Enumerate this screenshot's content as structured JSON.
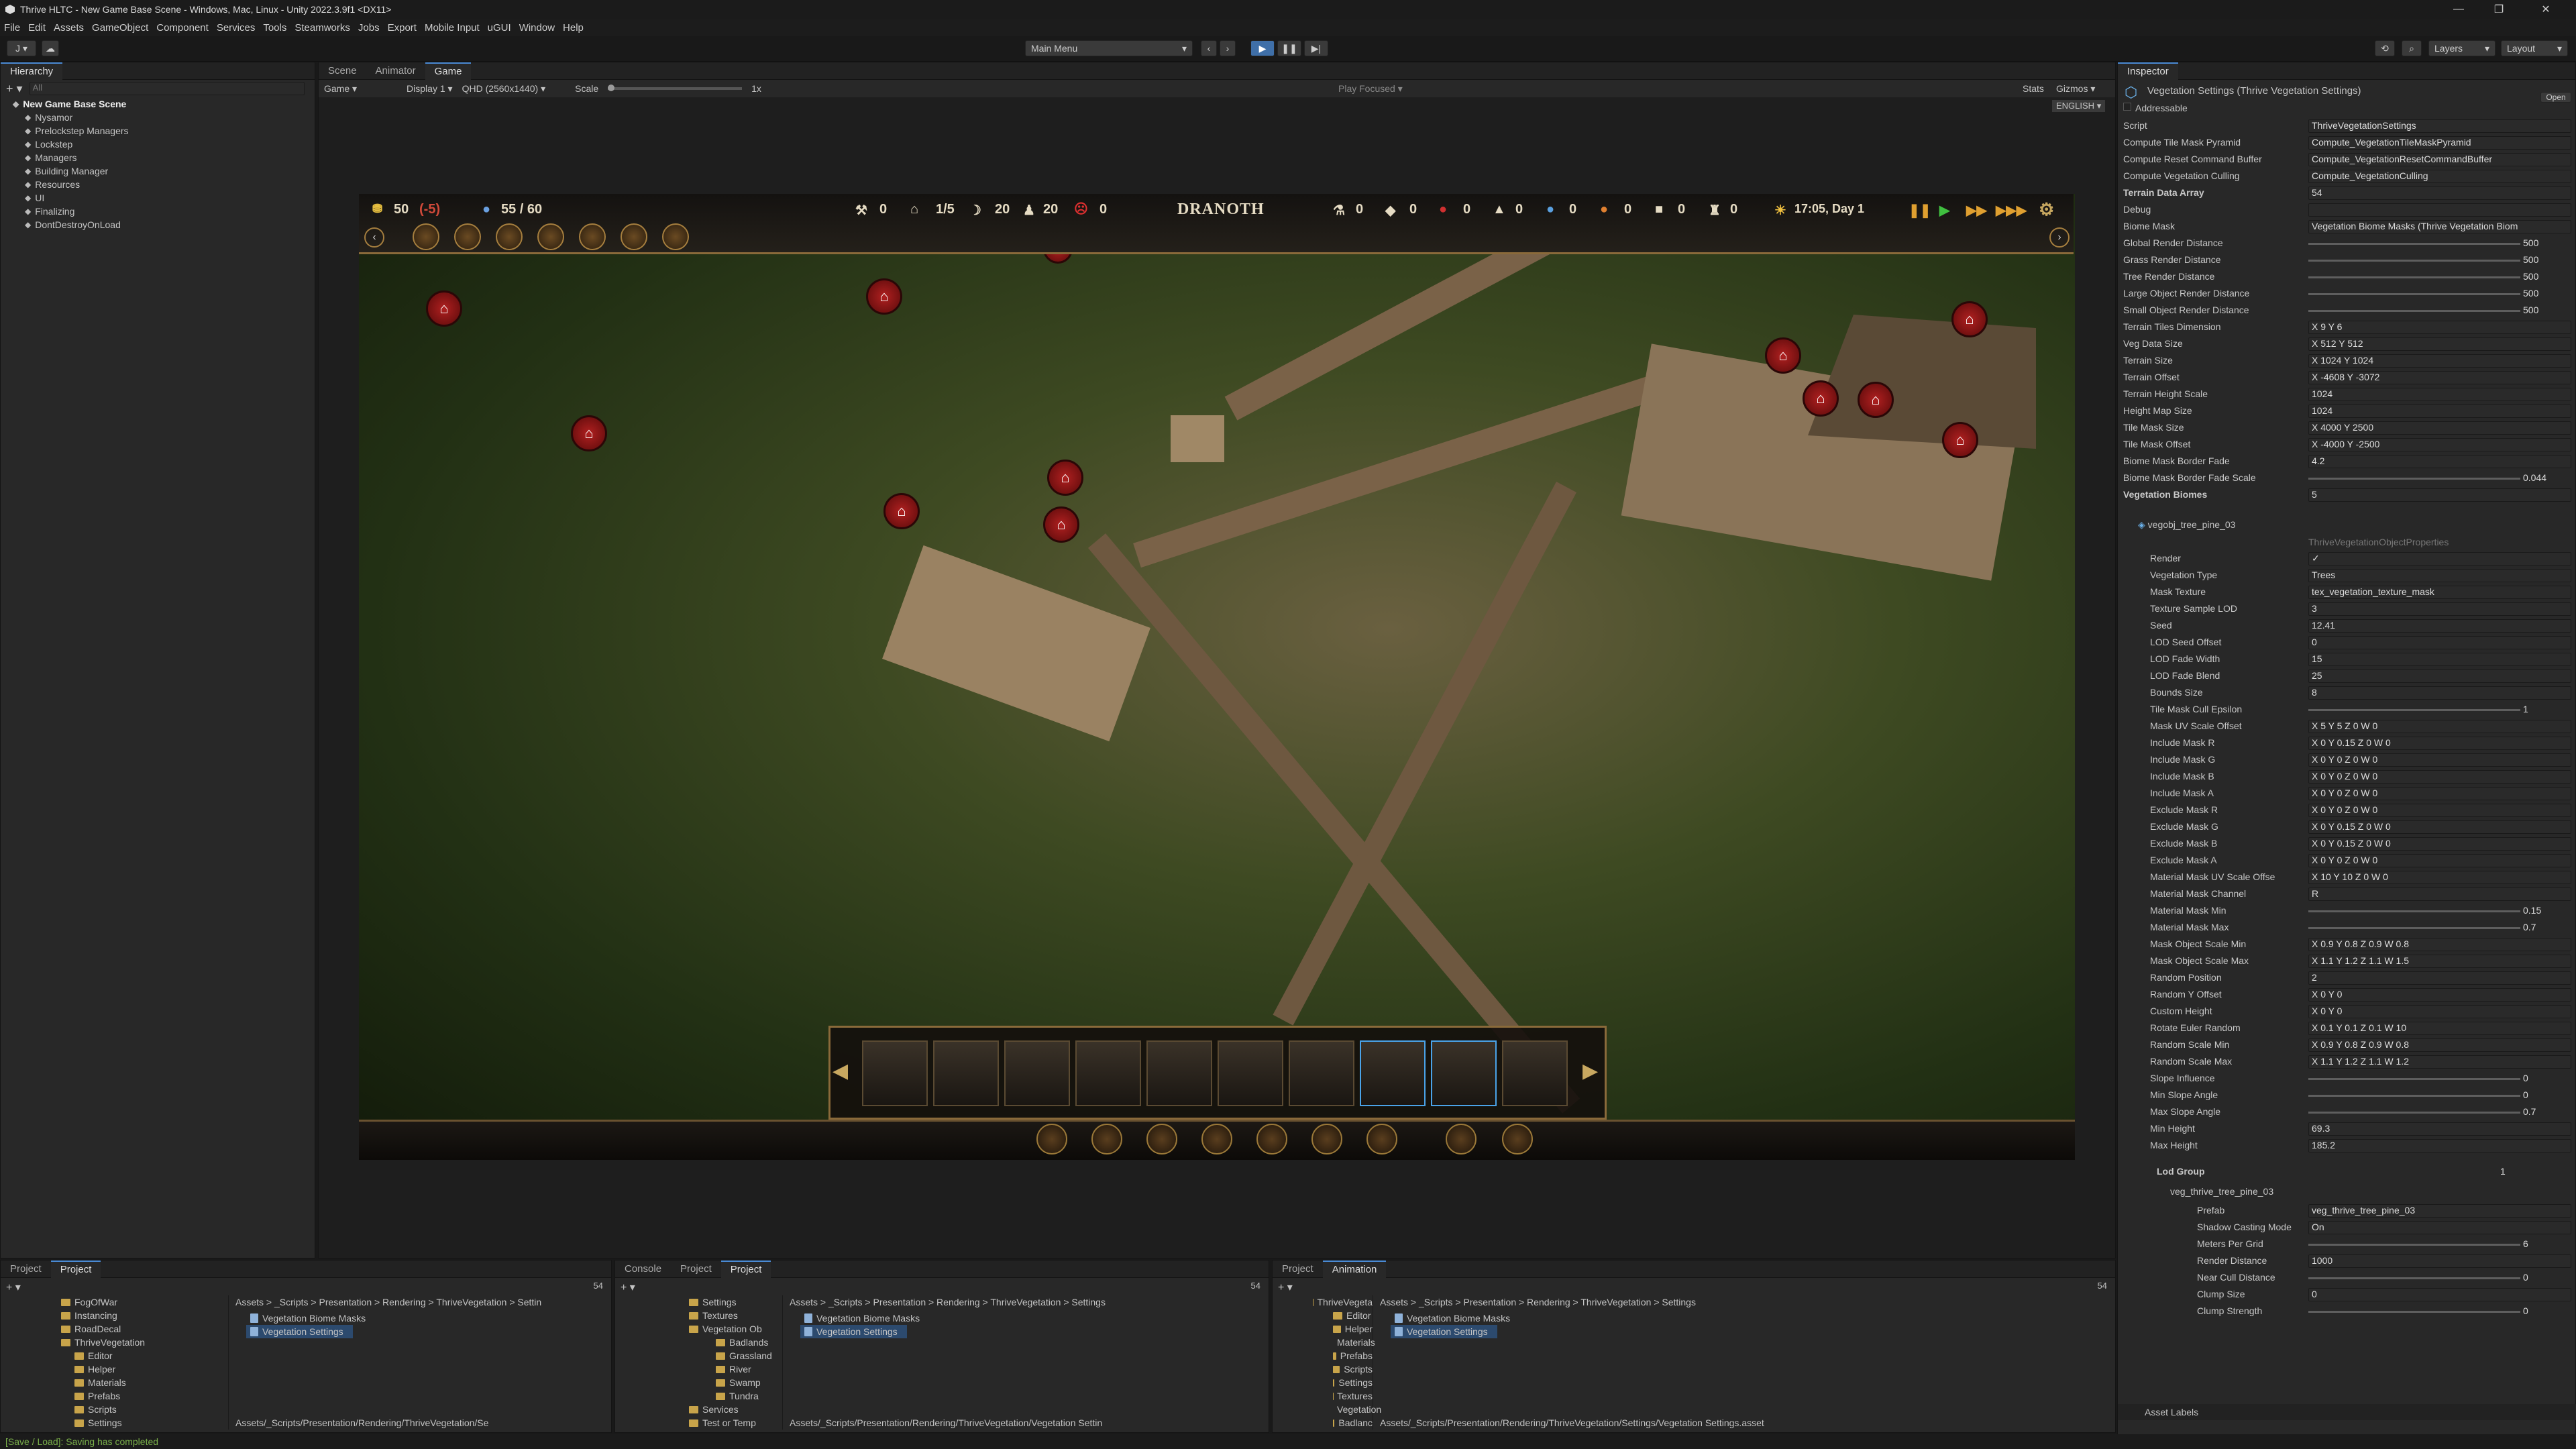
{
  "window": {
    "title": "Thrive HLTC - New Game Base Scene - Windows, Mac, Linux - Unity 2022.3.9f1 <DX11>"
  },
  "menu": [
    "File",
    "Edit",
    "Assets",
    "GameObject",
    "Component",
    "Services",
    "Tools",
    "Steamworks",
    "Jobs",
    "Export",
    "Mobile Input",
    "uGUI",
    "Window",
    "Help"
  ],
  "toolbar": {
    "account": "J",
    "scene_dropdown": "Main Menu",
    "layers": "Layers",
    "layout": "Layout"
  },
  "hierarchy": {
    "tab": "Hierarchy",
    "search_placeholder": "All",
    "scene": "New Game Base Scene",
    "items": [
      "Nysamor",
      "Prelockstep Managers",
      "Lockstep",
      "Managers",
      "Building Manager",
      "Resources",
      "UI",
      "Finalizing",
      "DontDestroyOnLoad"
    ]
  },
  "center_tabs": [
    "Scene",
    "Animator",
    "Game"
  ],
  "game_toolbar": {
    "mode": "Game",
    "display": "Display 1",
    "resolution": "QHD (2560x1440)",
    "scale_label": "Scale",
    "scale_value": "1x",
    "play_focused": "Play Focused",
    "stats": "Stats",
    "gizmos": "Gizmos",
    "language": "ENGLISH"
  },
  "hud": {
    "gold": "50",
    "gold_delta": "(-5)",
    "population": "55 / 60",
    "workers": "0",
    "housing": "1/5",
    "food": "20",
    "people": "20",
    "unrest": "0",
    "settlement": "DRANOTH",
    "res1": "0",
    "res2": "0",
    "res3": "0",
    "res4": "0",
    "res5": "0",
    "res6": "0",
    "res7": "0",
    "time": "17:05, Day 1"
  },
  "inspector": {
    "tab": "Inspector",
    "object": "Vegetation Settings (Thrive Vegetation Settings)",
    "open": "Open",
    "addressable": "Addressable",
    "fields": [
      {
        "label": "Script",
        "value": "ThriveVegetationSettings"
      },
      {
        "label": "Compute Tile Mask Pyramid",
        "value": "Compute_VegetationTileMaskPyramid"
      },
      {
        "label": "Compute Reset Command Buffer",
        "value": "Compute_VegetationResetCommandBuffer"
      },
      {
        "label": "Compute Vegetation Culling",
        "value": "Compute_VegetationCulling"
      },
      {
        "label": "Terrain Data Array",
        "value": "54"
      },
      {
        "label": "Debug",
        "value": ""
      },
      {
        "label": "Biome Mask",
        "value": "Vegetation Biome Masks (Thrive Vegetation Biom"
      },
      {
        "label": "Global Render Distance",
        "value": "500"
      },
      {
        "label": "Grass Render Distance",
        "value": "500"
      },
      {
        "label": "Tree Render Distance",
        "value": "500"
      },
      {
        "label": "Large Object Render Distance",
        "value": "500"
      },
      {
        "label": "Small Object Render Distance",
        "value": "500"
      },
      {
        "label": "Terrain Tiles Dimension",
        "value": "X 9   Y 6"
      },
      {
        "label": "Veg Data Size",
        "value": "X 512   Y 512"
      },
      {
        "label": "Terrain Size",
        "value": "X 1024   Y 1024"
      },
      {
        "label": "Terrain Offset",
        "value": "X -4608   Y -3072"
      },
      {
        "label": "Terrain Height Scale",
        "value": "1024"
      },
      {
        "label": "Height Map Size",
        "value": "1024"
      },
      {
        "label": "Tile Mask Size",
        "value": "X 4000   Y 2500"
      },
      {
        "label": "Tile Mask Offset",
        "value": "X -4000   Y -2500"
      },
      {
        "label": "Biome Mask Border Fade",
        "value": "4.2"
      },
      {
        "label": "Biome Mask Border Fade Scale",
        "value": "0.044"
      },
      {
        "label": "Vegetation Biomes",
        "value": "5"
      }
    ],
    "element": "vegobj_tree_pine_03",
    "element_script": "ThriveVegetationObjectProperties",
    "element_fields": [
      {
        "label": "Render",
        "value": "✓"
      },
      {
        "label": "Vegetation Type",
        "value": "Trees"
      },
      {
        "label": "Mask Texture",
        "value": "tex_vegetation_texture_mask"
      },
      {
        "label": "Texture Sample LOD",
        "value": "3"
      },
      {
        "label": "Seed",
        "value": "12.41"
      },
      {
        "label": "LOD Seed Offset",
        "value": "0"
      },
      {
        "label": "LOD Fade Width",
        "value": "15"
      },
      {
        "label": "LOD Fade Blend",
        "value": "25"
      },
      {
        "label": "Bounds Size",
        "value": "8"
      },
      {
        "label": "Tile Mask Cull Epsilon",
        "value": "1"
      },
      {
        "label": "Mask UV Scale Offset",
        "value": "X 5   Y 5   Z 0   W 0"
      },
      {
        "label": "Include Mask R",
        "value": "X 0   Y 0.15   Z 0   W 0"
      },
      {
        "label": "Include Mask G",
        "value": "X 0   Y 0   Z 0   W 0"
      },
      {
        "label": "Include Mask B",
        "value": "X 0   Y 0   Z 0   W 0"
      },
      {
        "label": "Include Mask A",
        "value": "X 0   Y 0   Z 0   W 0"
      },
      {
        "label": "Exclude Mask R",
        "value": "X 0   Y 0   Z 0   W 0"
      },
      {
        "label": "Exclude Mask G",
        "value": "X 0   Y 0.15   Z 0   W 0"
      },
      {
        "label": "Exclude Mask B",
        "value": "X 0   Y 0.15   Z 0   W 0"
      },
      {
        "label": "Exclude Mask A",
        "value": "X 0   Y 0   Z 0   W 0"
      },
      {
        "label": "Material Mask UV Scale Offse",
        "value": "X 10   Y 10   Z 0   W 0"
      },
      {
        "label": "Material Mask Channel",
        "value": "R"
      },
      {
        "label": "Material Mask Min",
        "value": "0.15"
      },
      {
        "label": "Material Mask Max",
        "value": "0.7"
      },
      {
        "label": "Mask Object Scale Min",
        "value": "X 0.9   Y 0.8   Z 0.9   W 0.8"
      },
      {
        "label": "Mask Object Scale Max",
        "value": "X 1.1   Y 1.2   Z 1.1   W 1.5"
      },
      {
        "label": "Random Position",
        "value": "2"
      },
      {
        "label": "Random Y Offset",
        "value": "X 0   Y 0"
      },
      {
        "label": "Custom Height",
        "value": "X 0   Y 0"
      },
      {
        "label": "Rotate Euler Random",
        "value": "X 0.1   Y 0.1   Z 0.1   W 10"
      },
      {
        "label": "Random Scale Min",
        "value": "X 0.9   Y 0.8   Z 0.9   W 0.8"
      },
      {
        "label": "Random Scale Max",
        "value": "X 1.1   Y 1.2   Z 1.1   W 1.2"
      },
      {
        "label": "Slope Influence",
        "value": "0"
      },
      {
        "label": "Min Slope Angle",
        "value": "0"
      },
      {
        "label": "Max Slope Angle",
        "value": "0.7"
      },
      {
        "label": "Min Height",
        "value": "69.3"
      },
      {
        "label": "Max Height",
        "value": "185.2"
      }
    ],
    "lod_group": {
      "label": "Lod Group",
      "value": "1",
      "child": "veg_thrive_tree_pine_03",
      "fields": [
        {
          "label": "Prefab",
          "value": "veg_thrive_tree_pine_03"
        },
        {
          "label": "Shadow Casting Mode",
          "value": "On"
        },
        {
          "label": "Meters Per Grid",
          "value": "6"
        },
        {
          "label": "Render Distance",
          "value": "1000"
        },
        {
          "label": "Near Cull Distance",
          "value": "0"
        },
        {
          "label": "Clump Size",
          "value": "0"
        },
        {
          "label": "Clump Strength",
          "value": "0"
        }
      ]
    },
    "asset_labels": "Asset Labels"
  },
  "bottom": {
    "p1": {
      "tabs": [
        "Project",
        "Project"
      ],
      "tree": [
        "FogOfWar",
        "Instancing",
        "RoadDecal",
        "ThriveVegetation",
        "Editor",
        "Helper",
        "Materials",
        "Prefabs",
        "Scripts",
        "Settings"
      ],
      "breadcrumb": "Assets > _Scripts > Presentation > Rendering > ThriveVegetation > Settin",
      "files": [
        "Vegetation Biome Masks",
        "Vegetation Settings"
      ],
      "path": "Assets/_Scripts/Presentation/Rendering/ThriveVegetation/Se"
    },
    "p2": {
      "tabs": [
        "Console",
        "Project",
        "Project"
      ],
      "tree": [
        "Settings",
        "Textures",
        "Vegetation Ob",
        "Badlands",
        "Grassland",
        "River",
        "Swamp",
        "Tundra",
        "Services",
        "Test or Temp"
      ],
      "breadcrumb": "Assets > _Scripts > Presentation > Rendering > ThriveVegetation > Settings",
      "files": [
        "Vegetation Biome Masks",
        "Vegetation Settings"
      ],
      "path": "Assets/_Scripts/Presentation/Rendering/ThriveVegetation/Vegetation Settin"
    },
    "p3": {
      "tabs": [
        "Project",
        "Animation"
      ],
      "tree": [
        "ThriveVegeta",
        "Editor",
        "Helper",
        "Materials",
        "Prefabs",
        "Scripts",
        "Settings",
        "Textures",
        "Vegetation",
        "Badlanc"
      ],
      "breadcrumb": "Assets > _Scripts > Presentation > Rendering > ThriveVegetation > Settings",
      "files": [
        "Vegetation Biome Masks",
        "Vegetation Settings"
      ],
      "path": "Assets/_Scripts/Presentation/Rendering/ThriveVegetation/Settings/Vegetation Settings.asset"
    },
    "count": "54"
  },
  "status": "[Save / Load]: Saving has completed"
}
